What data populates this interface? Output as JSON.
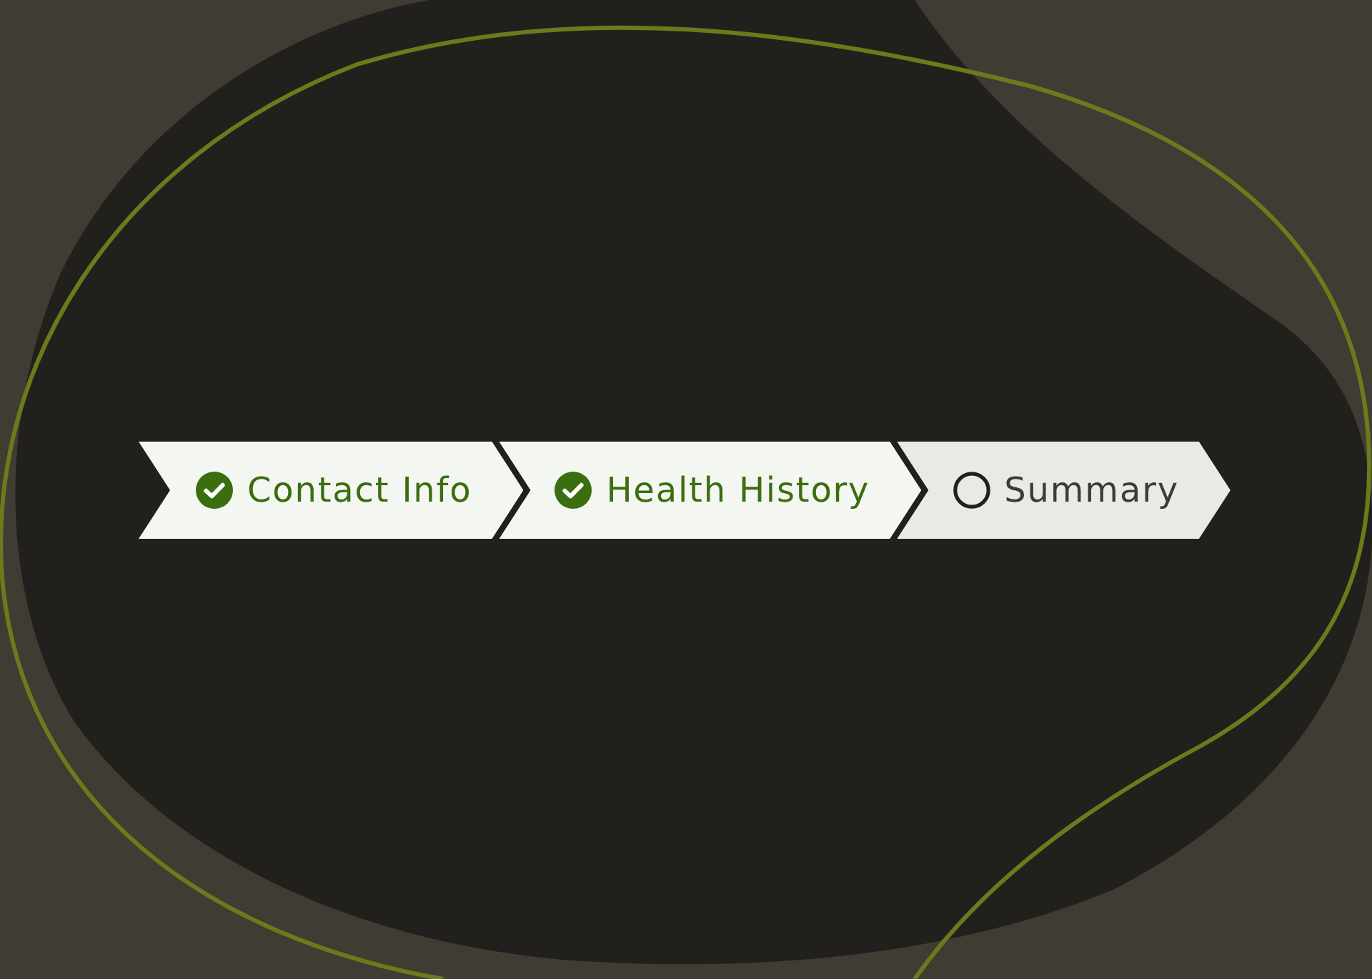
{
  "steps": [
    {
      "label": "Contact Info",
      "completed": true
    },
    {
      "label": "Health History",
      "completed": true
    },
    {
      "label": "Summary",
      "completed": false
    }
  ]
}
